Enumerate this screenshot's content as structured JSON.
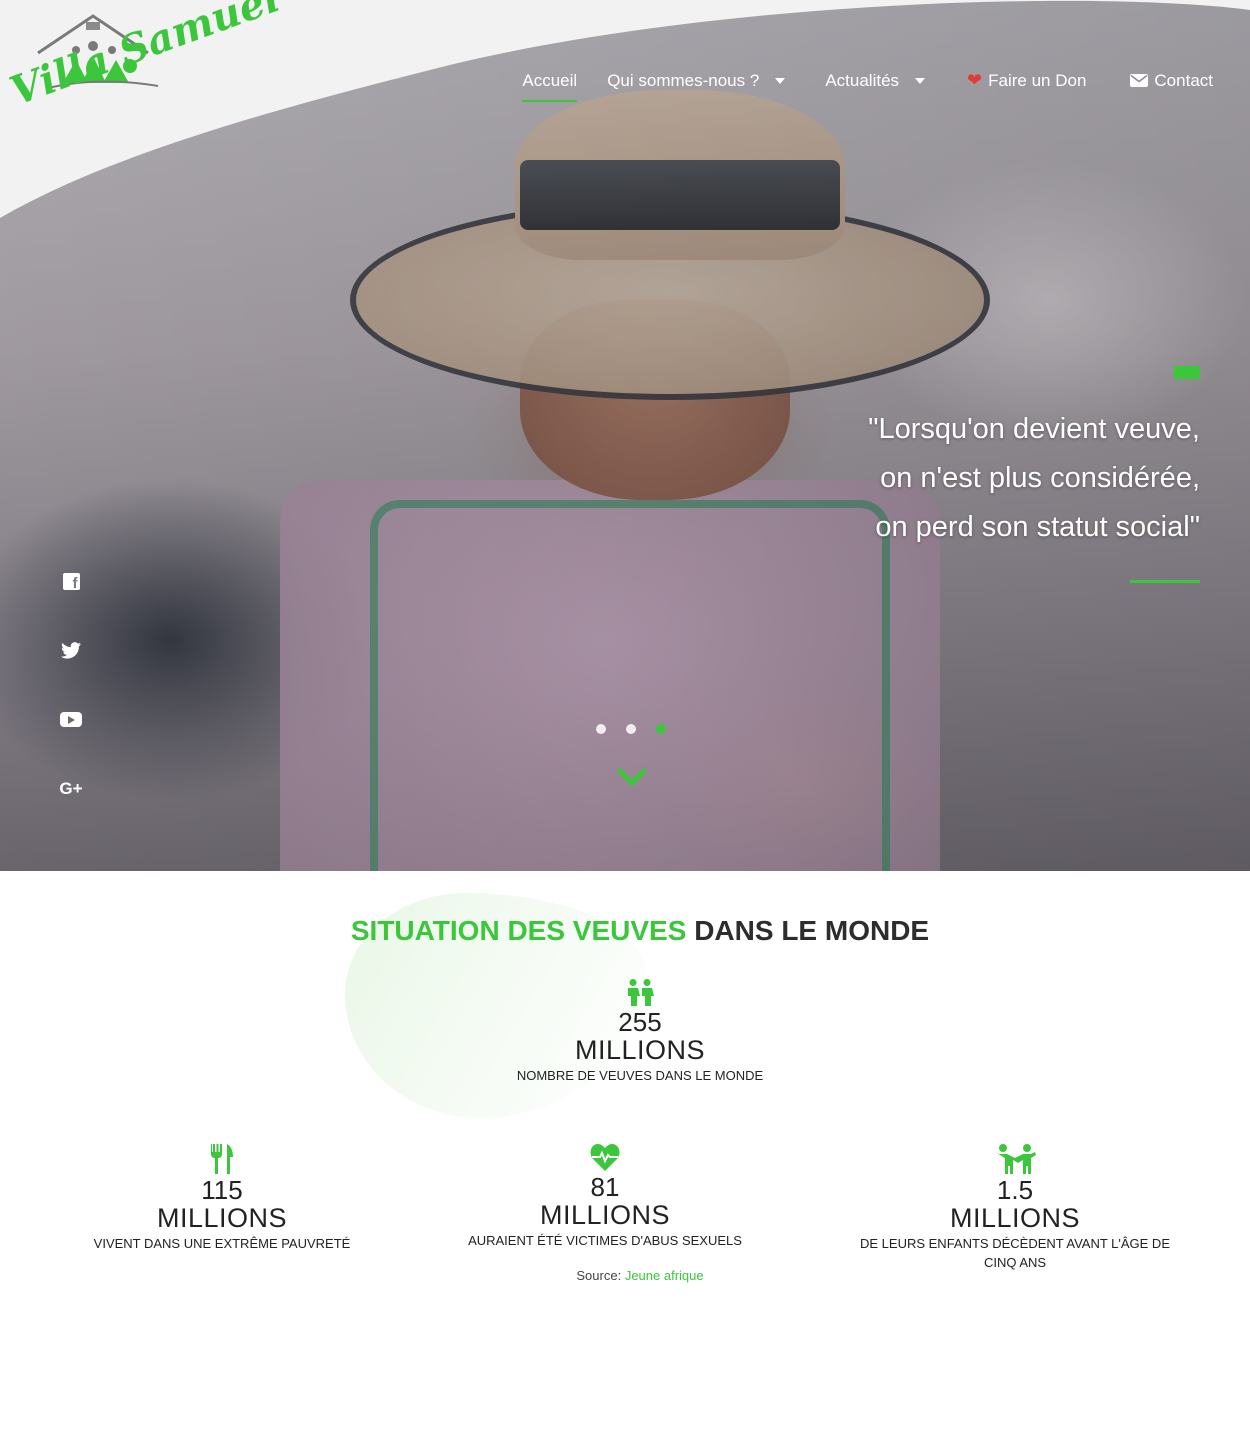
{
  "brand": {
    "logo_text": "Villa Samuel"
  },
  "nav": {
    "items": [
      {
        "label": "Accueil",
        "active": true
      },
      {
        "label": "Qui sommes-nous ?"
      },
      {
        "label": "Actualités"
      },
      {
        "label": "Faire un Don"
      },
      {
        "label": "Contact"
      }
    ]
  },
  "hero": {
    "quote_lines": [
      "\"Lorsqu'on devient veuve,",
      "on n'est plus considérée,",
      "on perd son statut social\""
    ],
    "socials": [
      "facebook-icon",
      "twitter-icon",
      "youtube-icon",
      "google-plus-icon"
    ],
    "google_plus_label": "G+",
    "slides": 3,
    "active_slide": 3
  },
  "stats": {
    "title_green": "SITUATION DES VEUVES",
    "title_rest": " DANS LE MONDE",
    "main": {
      "icon": "couple-icon",
      "number": "255",
      "unit": "MILLIONS",
      "desc": "NOMBRE DE VEUVES DANS LE MONDE"
    },
    "items": [
      {
        "icon": "fork-knife-icon",
        "number": "115",
        "unit": "MILLIONS",
        "desc": "VIVENT DANS UNE EXTRÊME PAUVRETÉ"
      },
      {
        "icon": "heartbeat-icon",
        "number": "81",
        "unit": "MILLIONS",
        "desc": "AURAIENT ÉTÉ VICTIMES D'ABUS SEXUELS"
      },
      {
        "icon": "children-icon",
        "number": "1.5",
        "unit": "MILLIONS",
        "desc": "DE LEURS ENFANTS DÉCÈDENT AVANT L'ÂGE DE CINQ ANS"
      }
    ],
    "source_label": "Source:",
    "source_link": "Jeune afrique"
  },
  "colors": {
    "accent": "#3cc63c",
    "heart": "#e53935"
  }
}
